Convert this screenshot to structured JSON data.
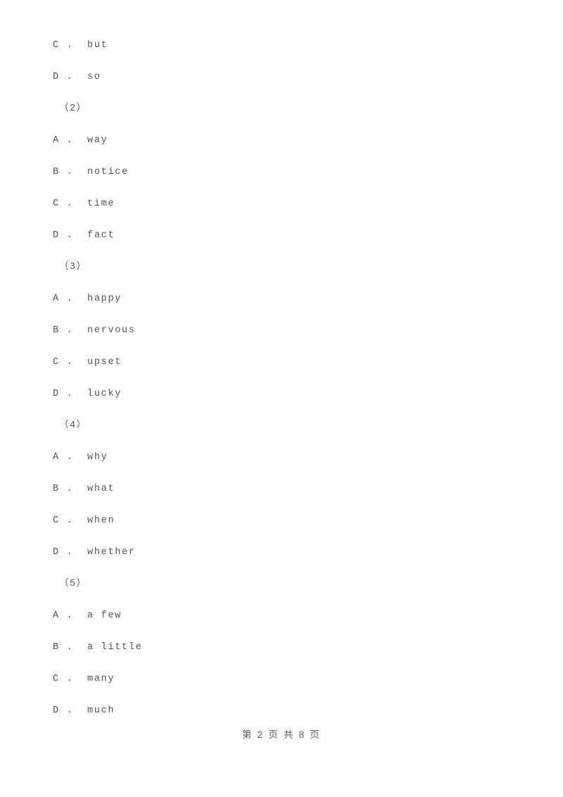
{
  "document": {
    "type": "exam-paper-page",
    "page_background": "#ffffff",
    "text_color": "#555459"
  },
  "lines": [
    {
      "kind": "option",
      "marker": "C",
      "separator": ".",
      "text": "but"
    },
    {
      "kind": "option",
      "marker": "D",
      "separator": ".",
      "text": "so"
    },
    {
      "kind": "question",
      "label": "（2）"
    },
    {
      "kind": "option",
      "marker": "A",
      "separator": ".",
      "text": "way"
    },
    {
      "kind": "option",
      "marker": "B",
      "separator": ".",
      "text": "notice"
    },
    {
      "kind": "option",
      "marker": "C",
      "separator": ".",
      "text": "time"
    },
    {
      "kind": "option",
      "marker": "D",
      "separator": ".",
      "text": "fact"
    },
    {
      "kind": "question",
      "label": "（3）"
    },
    {
      "kind": "option",
      "marker": "A",
      "separator": ".",
      "text": "happy"
    },
    {
      "kind": "option",
      "marker": "B",
      "separator": ".",
      "text": "nervous"
    },
    {
      "kind": "option",
      "marker": "C",
      "separator": ".",
      "text": "upset"
    },
    {
      "kind": "option",
      "marker": "D",
      "separator": ".",
      "text": "lucky"
    },
    {
      "kind": "question",
      "label": "（4）"
    },
    {
      "kind": "option",
      "marker": "A",
      "separator": ".",
      "text": "why"
    },
    {
      "kind": "option",
      "marker": "B",
      "separator": ".",
      "text": "what"
    },
    {
      "kind": "option",
      "marker": "C",
      "separator": ".",
      "text": "when"
    },
    {
      "kind": "option",
      "marker": "D",
      "separator": ".",
      "text": "whether"
    },
    {
      "kind": "question",
      "label": "（5）"
    },
    {
      "kind": "option",
      "marker": "A",
      "separator": ".",
      "text": "a few"
    },
    {
      "kind": "option",
      "marker": "B",
      "separator": ".",
      "text": "a little"
    },
    {
      "kind": "option",
      "marker": "C",
      "separator": ".",
      "text": "many"
    },
    {
      "kind": "option",
      "marker": "D",
      "separator": ".",
      "text": "much"
    }
  ],
  "footer": {
    "text": "第 2 页 共 8 页",
    "current_page": "2",
    "total_pages": "8"
  }
}
